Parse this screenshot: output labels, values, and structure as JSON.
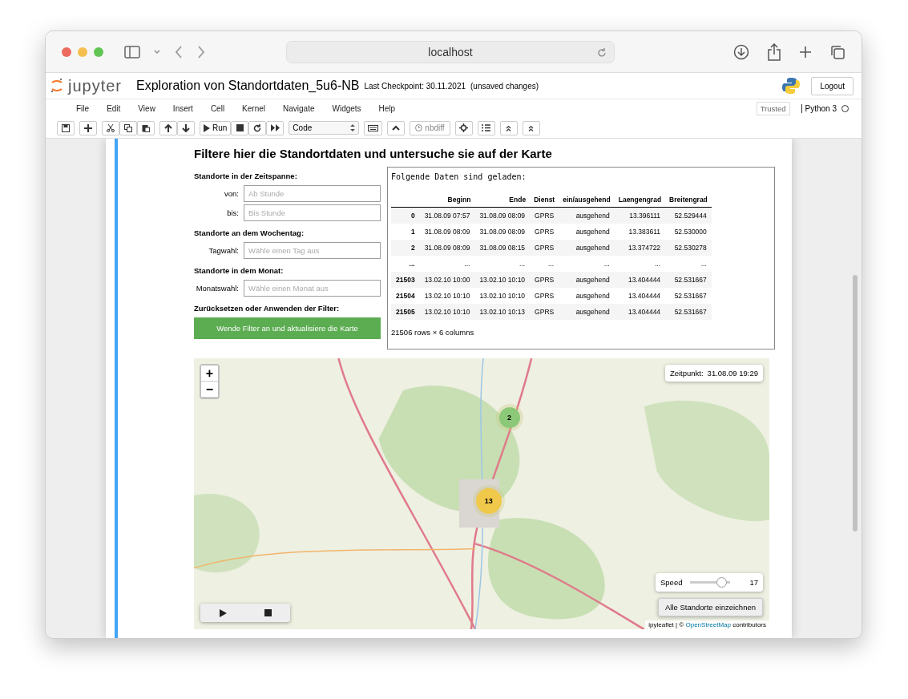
{
  "browser": {
    "address": "localhost"
  },
  "notebook": {
    "logo": "jupyter",
    "title": "Exploration von Standortdaten_5u6-NB",
    "checkpoint": "Last Checkpoint: 30.11.2021",
    "unsaved": "(unsaved changes)",
    "logout": "Logout"
  },
  "menu": [
    "File",
    "Edit",
    "View",
    "Insert",
    "Cell",
    "Kernel",
    "Navigate",
    "Widgets",
    "Help"
  ],
  "trusted": "Trusted",
  "kernel": "Python 3",
  "toolbar": {
    "run": "Run",
    "cell_type": "Code",
    "nbdiff": "nbdiff"
  },
  "heading": "Filtere hier die Standortdaten und untersuche sie auf der Karte",
  "filters": [
    {
      "kind": "section",
      "text": "Standorte in der Zeitspanne:"
    },
    {
      "kind": "field",
      "label": "von:",
      "placeholder": "Ab Stunde"
    },
    {
      "kind": "field",
      "label": "bis:",
      "placeholder": "Bis Stunde"
    },
    {
      "kind": "section",
      "text": "Standorte an dem Wochentag:"
    },
    {
      "kind": "field",
      "label": "Tagwahl:",
      "placeholder": "Wähle einen Tag aus"
    },
    {
      "kind": "section",
      "text": "Standorte in dem Monat:"
    },
    {
      "kind": "field",
      "label": "Monatswahl:",
      "placeholder": "Wähle einen Monat aus"
    },
    {
      "kind": "section",
      "text": "Zurücksetzen oder Anwenden der Filter:"
    },
    {
      "kind": "button",
      "text": "Wende Filter an und aktualisiere die Karte"
    }
  ],
  "output": {
    "caption": "Folgende Daten sind geladen:",
    "table": {
      "columns": [
        "",
        "Beginn",
        "Ende",
        "Dienst",
        "ein/ausgehend",
        "Laengengrad",
        "Breitengrad"
      ],
      "rows": [
        [
          "0",
          "31.08.09 07:57",
          "31.08.09 08:09",
          "GPRS",
          "ausgehend",
          "13.396111",
          "52.529444"
        ],
        [
          "1",
          "31.08.09 08:09",
          "31.08.09 08:09",
          "GPRS",
          "ausgehend",
          "13.383611",
          "52.530000"
        ],
        [
          "2",
          "31.08.09 08:09",
          "31.08.09 08:15",
          "GPRS",
          "ausgehend",
          "13.374722",
          "52.530278"
        ],
        [
          "...",
          "...",
          "...",
          "...",
          "...",
          "...",
          "..."
        ],
        [
          "21503",
          "13.02.10 10:00",
          "13.02.10 10:10",
          "GPRS",
          "ausgehend",
          "13.404444",
          "52.531667"
        ],
        [
          "21504",
          "13.02.10 10:10",
          "13.02.10 10:10",
          "GPRS",
          "ausgehend",
          "13.404444",
          "52.531667"
        ],
        [
          "21505",
          "13.02.10 10:10",
          "13.02.10 10:13",
          "GPRS",
          "ausgehend",
          "13.404444",
          "52.531667"
        ]
      ]
    },
    "shape": "21506 rows × 6 columns"
  },
  "map": {
    "zoom_in": "+",
    "zoom_out": "−",
    "time_label": "Zeitpunkt:",
    "time": "31.08.09 19:29",
    "clusters": [
      {
        "count": "2",
        "color": "#8bc878"
      },
      {
        "count": "13",
        "color": "#f0c84a"
      }
    ],
    "speed": {
      "label": "Speed",
      "level": 0.88,
      "reading": "17"
    },
    "draw_all": "Alle Standorte einzeichnen",
    "attribution": "ipyleaflet | © ",
    "attribution_link": "OpenStreetMap",
    "attribution_end": " contributors"
  }
}
